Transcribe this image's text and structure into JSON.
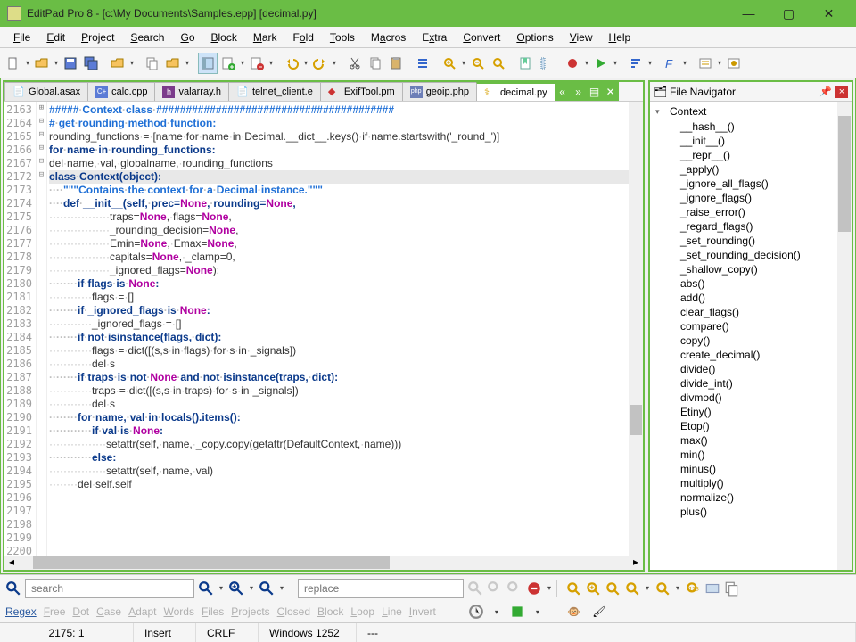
{
  "window": {
    "title": "EditPad Pro 8 - [c:\\My Documents\\Samples.epp] [decimal.py]"
  },
  "menu": [
    "File",
    "Edit",
    "Project",
    "Search",
    "Go",
    "Block",
    "Mark",
    "Fold",
    "Tools",
    "Macros",
    "Extra",
    "Convert",
    "Options",
    "View",
    "Help"
  ],
  "tabs": [
    {
      "label": "Global.asax"
    },
    {
      "label": "calc.cpp"
    },
    {
      "label": "valarray.h"
    },
    {
      "label": "telnet_client.e"
    },
    {
      "label": "ExifTool.pm"
    },
    {
      "label": "geoip.php"
    },
    {
      "label": "decimal.py",
      "active": true
    }
  ],
  "navigator": {
    "title": "File Navigator",
    "root": "Context",
    "items": [
      "__hash__()",
      "__init__()",
      "__repr__()",
      "_apply()",
      "_ignore_all_flags()",
      "_ignore_flags()",
      "_raise_error()",
      "_regard_flags()",
      "_set_rounding()",
      "_set_rounding_decision()",
      "_shallow_copy()",
      "abs()",
      "add()",
      "clear_flags()",
      "compare()",
      "copy()",
      "create_decimal()",
      "divide()",
      "divide_int()",
      "divmod()",
      "Etiny()",
      "Etop()",
      "max()",
      "min()",
      "minus()",
      "multiply()",
      "normalize()",
      "plus()"
    ]
  },
  "code": {
    "line_numbers": [
      "2163",
      "2164",
      "2165",
      "2166",
      "2167",
      "2172",
      "2173",
      "2174",
      "2175",
      "2176",
      "2177",
      "2178",
      "2179",
      "2180",
      "2181",
      "2182",
      "2183",
      "2184",
      "2185",
      "2186",
      "2187",
      "2188",
      "2189",
      "2190",
      "2191",
      "2192",
      "2193",
      "2194",
      "2195",
      "2196",
      "2197",
      "2198",
      "2199",
      "2200"
    ],
    "fold": [
      "",
      "",
      "",
      "",
      "⊞",
      "",
      "",
      "",
      "⊟",
      "",
      "",
      "⊟",
      "",
      "",
      "",
      "",
      "",
      "",
      "",
      "",
      "",
      "⊟",
      "",
      "",
      "⊟",
      "",
      "",
      "⊟",
      "",
      "",
      "",
      "",
      "",
      ""
    ],
    "lines": [
      {
        "t": "#####·Context·class·########################################",
        "cls": "c-blue"
      },
      {
        "t": "",
        "cls": ""
      },
      {
        "t": "#·get·rounding·method·function:",
        "cls": "c-blue"
      },
      {
        "t": "rounding_functions·=·[name·for·name·in·Decimal.__dict__.keys()·if·name.startswith('_round_')]",
        "cls": "c-text"
      },
      {
        "t": "for·name·in·rounding_functions:",
        "cls": "c-navy",
        "dash": true
      },
      {
        "t": "",
        "cls": ""
      },
      {
        "t": "del·name,·val,·globalname,·rounding_functions",
        "cls": "c-text"
      },
      {
        "t": "",
        "cls": ""
      },
      {
        "t": "class·Context(object):",
        "cls": "c-navy",
        "hl": true
      },
      {
        "t": "····\"\"\"Contains·the·context·for·a·Decimal·instance.\"\"\"",
        "cls": "c-blue",
        "dots": true
      },
      {
        "t": "",
        "cls": ""
      },
      {
        "t": "····def·__init__(self,·prec=None,·rounding=None,",
        "cls": "c-navy",
        "dots": true
      },
      {
        "t": "·················traps=None,·flags=None,",
        "cls": "c-text",
        "dots": true
      },
      {
        "t": "·················_rounding_decision=None,",
        "cls": "c-text",
        "dots": true
      },
      {
        "t": "·················Emin=None,·Emax=None,",
        "cls": "c-text",
        "dots": true
      },
      {
        "t": "·················capitals=None,·_clamp=0,",
        "cls": "c-text",
        "dots": true
      },
      {
        "t": "·················_ignored_flags=None):",
        "cls": "c-text",
        "dots": true
      },
      {
        "t": "········if·flags·is·None:",
        "cls": "c-navy",
        "dots": true
      },
      {
        "t": "············flags·=·[]",
        "cls": "c-text",
        "dots": true
      },
      {
        "t": "········if·_ignored_flags·is·None:",
        "cls": "c-navy",
        "dots": true
      },
      {
        "t": "············_ignored_flags·=·[]",
        "cls": "c-text",
        "dots": true
      },
      {
        "t": "········if·not·isinstance(flags,·dict):",
        "cls": "c-navy",
        "dots": true
      },
      {
        "t": "············flags·=·dict([(s,s·in·flags)·for·s·in·_signals])",
        "cls": "c-text",
        "dots": true
      },
      {
        "t": "············del·s",
        "cls": "c-text",
        "dots": true
      },
      {
        "t": "········if·traps·is·not·None·and·not·isinstance(traps,·dict):",
        "cls": "c-navy",
        "dots": true
      },
      {
        "t": "············traps·=·dict([(s,s·in·traps)·for·s·in·_signals])",
        "cls": "c-text",
        "dots": true
      },
      {
        "t": "············del·s",
        "cls": "c-text",
        "dots": true
      },
      {
        "t": "········for·name,·val·in·locals().items():",
        "cls": "c-navy",
        "dots": true
      },
      {
        "t": "············if·val·is·None:",
        "cls": "c-navy",
        "dots": true
      },
      {
        "t": "················setattr(self,·name,·_copy.copy(getattr(DefaultContext,·name)))",
        "cls": "c-text",
        "dots": true
      },
      {
        "t": "············else:",
        "cls": "c-navy",
        "dots": true
      },
      {
        "t": "················setattr(self,·name,·val)",
        "cls": "c-text",
        "dots": true
      },
      {
        "t": "········del·self.self",
        "cls": "c-text",
        "dots": true
      },
      {
        "t": "",
        "cls": ""
      }
    ]
  },
  "search": {
    "search_ph": "search",
    "replace_ph": "replace"
  },
  "options": [
    "Regex",
    "Free",
    "Dot",
    "Case",
    "Adapt",
    "Words",
    "Files",
    "Projects",
    "Closed",
    "Block",
    "Loop",
    "Line",
    "Invert"
  ],
  "options_state": [
    "on",
    "off",
    "off",
    "off",
    "off",
    "off",
    "off",
    "off",
    "off",
    "off",
    "off",
    "off",
    "off"
  ],
  "status": {
    "pos": "2175: 1",
    "mode": "Insert",
    "eol": "CRLF",
    "enc": "Windows 1252",
    "extra": "---"
  }
}
